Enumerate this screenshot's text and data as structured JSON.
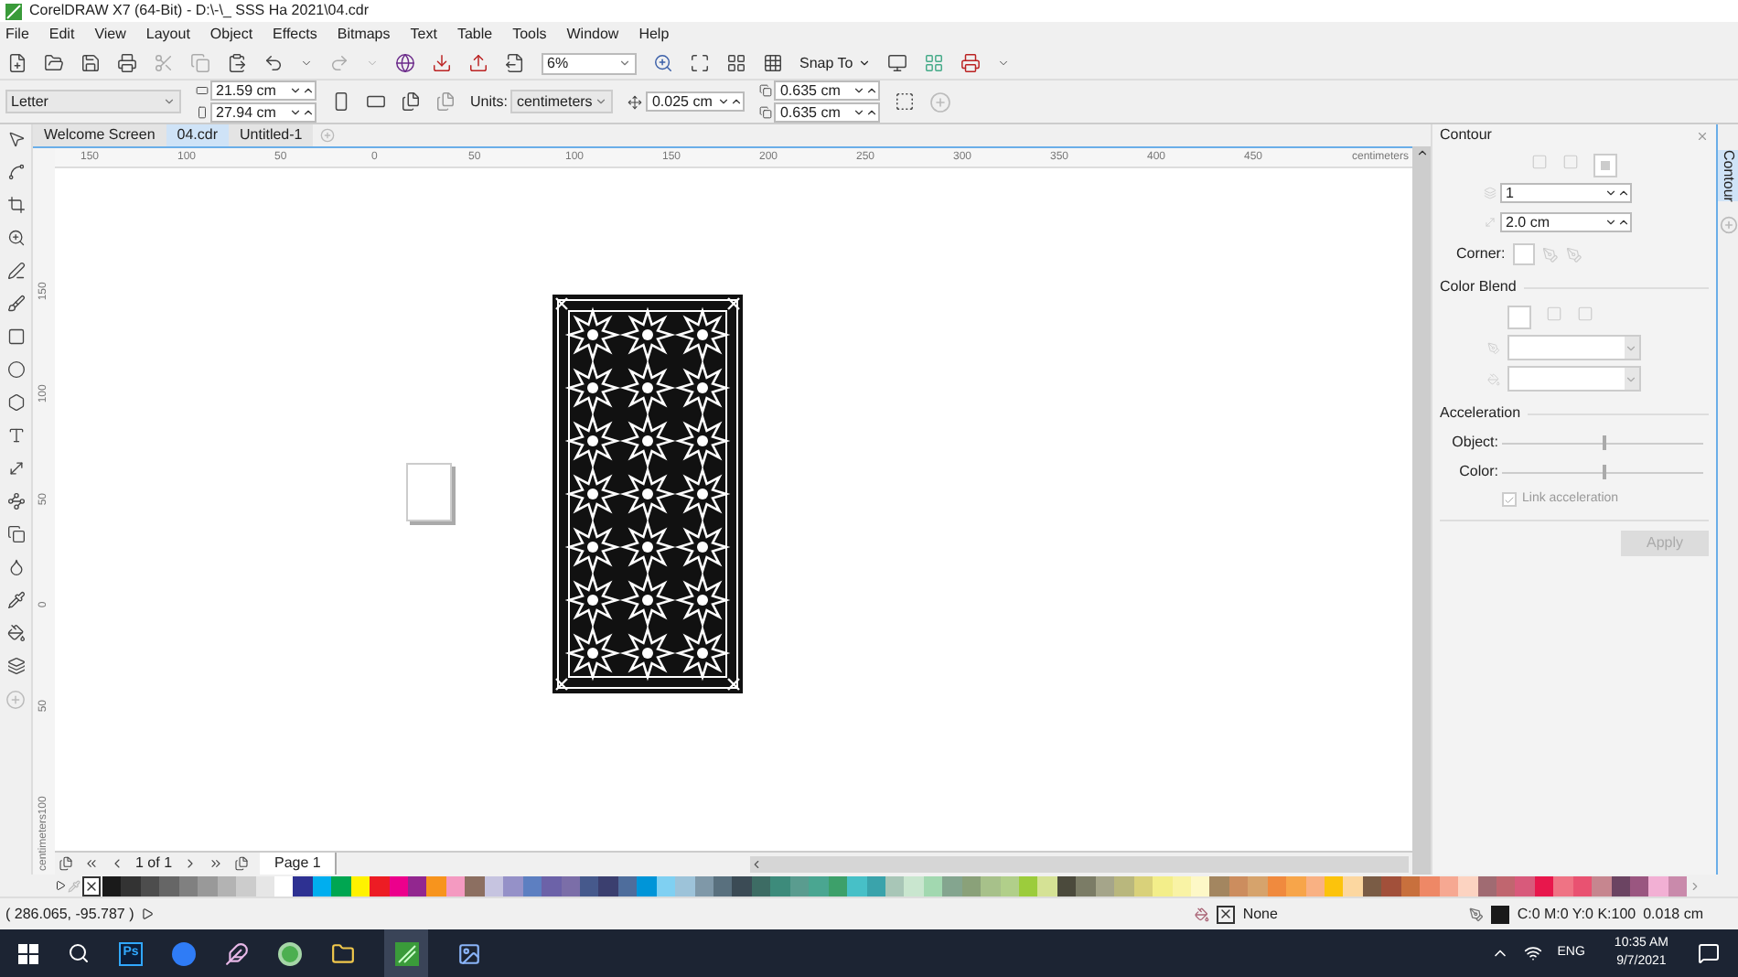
{
  "window": {
    "title": "CorelDRAW X7 (64-Bit) - D:\\-\\_ SSS Ha 2021\\04.cdr"
  },
  "menu": [
    "File",
    "Edit",
    "View",
    "Layout",
    "Object",
    "Effects",
    "Bitmaps",
    "Text",
    "Table",
    "Tools",
    "Window",
    "Help"
  ],
  "toolbar": {
    "zoom": "6%",
    "snap": "Snap To"
  },
  "property_bar": {
    "paper": "Letter",
    "width": "21.59 cm",
    "height": "27.94 cm",
    "units_label": "Units:",
    "units": "centimeters",
    "nudge": "0.025 cm",
    "dup_h": "0.635 cm",
    "dup_v": "0.635 cm"
  },
  "document_tabs": [
    {
      "label": "Welcome Screen",
      "selected": false
    },
    {
      "label": "04.cdr",
      "selected": true
    },
    {
      "label": "Untitled-1",
      "selected": false
    }
  ],
  "horizontal_ruler": {
    "ticks": [
      "150",
      "100",
      "50",
      "0",
      "50",
      "100",
      "150",
      "200",
      "250",
      "300",
      "350",
      "400",
      "450"
    ],
    "unit": "centimeters"
  },
  "vertical_ruler": {
    "ticks": [
      "150",
      "100",
      "50",
      "0",
      "50",
      "100"
    ],
    "unit": "centimeters"
  },
  "page_navigator": {
    "count": "1 of 1",
    "tabs": [
      {
        "label": "Page 1",
        "selected": true
      }
    ]
  },
  "palette": [
    {
      "color": "#1a1a1a"
    },
    {
      "color": "#333333"
    },
    {
      "color": "#4d4d4d"
    },
    {
      "color": "#666666"
    },
    {
      "color": "#808080"
    },
    {
      "color": "#999999"
    },
    {
      "color": "#b3b3b3"
    },
    {
      "color": "#cccccc"
    },
    {
      "color": "#e6e6e6"
    },
    {
      "color": "#ffffff"
    },
    {
      "color": "#2e3192"
    },
    {
      "color": "#00aeef"
    },
    {
      "color": "#00a651"
    },
    {
      "color": "#fff200"
    },
    {
      "color": "#ed1c24"
    },
    {
      "color": "#ec008c"
    },
    {
      "color": "#92278f"
    },
    {
      "color": "#f7941d"
    },
    {
      "color": "#f49ac1"
    },
    {
      "color": "#8c6f61"
    },
    {
      "color": "#c6c4e0"
    },
    {
      "color": "#9591c8"
    },
    {
      "color": "#5d7fc1"
    },
    {
      "color": "#6c62a8"
    },
    {
      "color": "#7b6ea8"
    },
    {
      "color": "#46598c"
    },
    {
      "color": "#3b3f6f"
    },
    {
      "color": "#4e6d9c"
    },
    {
      "color": "#0095d8"
    },
    {
      "color": "#7fd0f2"
    },
    {
      "color": "#9dc3d9"
    },
    {
      "color": "#7f98a8"
    },
    {
      "color": "#59707e"
    },
    {
      "color": "#3b4b55"
    },
    {
      "color": "#3d6c64"
    },
    {
      "color": "#3d8b7b"
    },
    {
      "color": "#5a9c8f"
    },
    {
      "color": "#4aa691"
    },
    {
      "color": "#3da06a"
    },
    {
      "color": "#47c0c7"
    },
    {
      "color": "#3aa3ab"
    },
    {
      "color": "#a8c6b7"
    },
    {
      "color": "#c9e6cf"
    },
    {
      "color": "#a2d8b0"
    },
    {
      "color": "#84a58f"
    },
    {
      "color": "#8aa179"
    },
    {
      "color": "#a7c18a"
    },
    {
      "color": "#b1cf8a"
    },
    {
      "color": "#9ccc3c"
    },
    {
      "color": "#d5e295"
    },
    {
      "color": "#4b4a3c"
    },
    {
      "color": "#7b7c66"
    },
    {
      "color": "#a5a58a"
    },
    {
      "color": "#b9b77d"
    },
    {
      "color": "#d9d17a"
    },
    {
      "color": "#f3ee8a"
    },
    {
      "color": "#f9f3a5"
    },
    {
      "color": "#fdf8c7"
    },
    {
      "color": "#a38660"
    },
    {
      "color": "#cc8d5e"
    },
    {
      "color": "#d6a36c"
    },
    {
      "color": "#f08a3e"
    },
    {
      "color": "#f7a54a"
    },
    {
      "color": "#f9b183"
    },
    {
      "color": "#fcc30c"
    },
    {
      "color": "#fcd7a0"
    },
    {
      "color": "#7a5c45"
    },
    {
      "color": "#a2503a"
    },
    {
      "color": "#c8703d"
    },
    {
      "color": "#ee8866"
    },
    {
      "color": "#f6a892"
    },
    {
      "color": "#fcd3c1"
    },
    {
      "color": "#a06b72"
    },
    {
      "color": "#c0666f"
    },
    {
      "color": "#d85a7b"
    },
    {
      "color": "#e8174c"
    },
    {
      "color": "#ef7384"
    },
    {
      "color": "#e95271"
    },
    {
      "color": "#c6868f"
    },
    {
      "color": "#6b4462"
    },
    {
      "color": "#9a5680"
    },
    {
      "color": "#f2b0d4"
    },
    {
      "color": "#c98aab"
    }
  ],
  "docker": {
    "title": "Contour",
    "steps": "1",
    "offset": "2.0 cm",
    "corner_label": "Corner:",
    "color_blend": "Color Blend",
    "acceleration": "Acceleration",
    "sliders": [
      {
        "label": "Object:",
        "level": 0.5
      },
      {
        "label": "Color:",
        "level": 0.5
      }
    ],
    "link": {
      "label": "Link acceleration",
      "checked": true
    },
    "apply": {
      "label": "Apply",
      "disabled": true
    },
    "side_tab": "Contour"
  },
  "status_bar": {
    "coordinates": "( 286.065, -95.787 )",
    "fill": "None",
    "outline": "C:0 M:0 Y:0 K:100",
    "outline_width": "0.018 cm"
  },
  "taskbar": {
    "photoshop": "Ps",
    "language": "ENG",
    "time": "10:35 AM",
    "date": "9/7/2021"
  }
}
